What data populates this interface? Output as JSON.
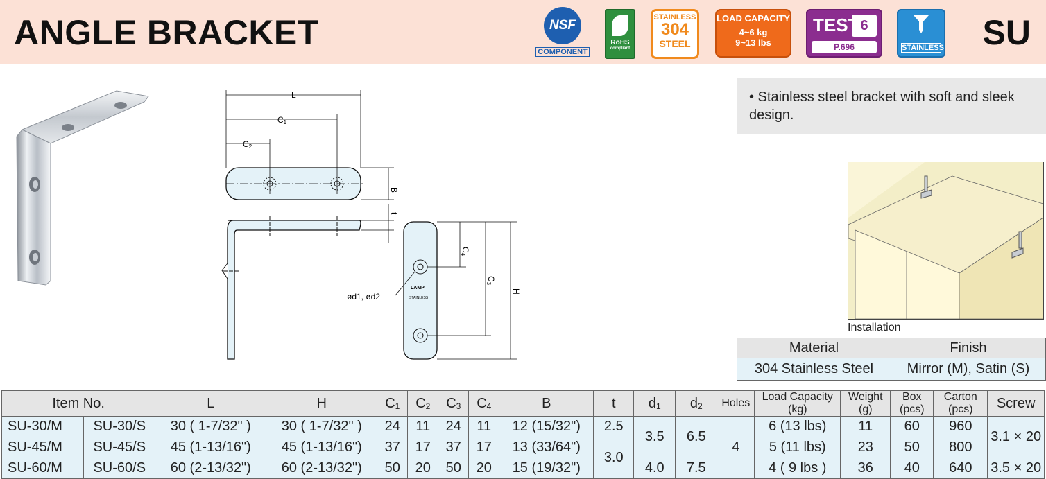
{
  "header": {
    "title": "ANGLE BRACKET",
    "series": "SU",
    "badges": {
      "nsf_logo": "NSF",
      "nsf_label": "COMPONENT",
      "rohs_label": "RoHS",
      "rohs_sub": "compliant",
      "steel_top": "STAINLESS",
      "steel_mid": "304",
      "steel_bot": "STEEL",
      "load_title": "LOAD CAPACITY",
      "load_kg": "4~6 kg",
      "load_lbs": "9~13 lbs",
      "test_label": "TEST",
      "test_num": "6",
      "test_page": "P.696",
      "stainless_label": "STAINLESS"
    }
  },
  "description": "• Stainless steel bracket with soft and sleek design.",
  "drawing_labels": {
    "L": "L",
    "C1": "C",
    "C1_sub": "1",
    "C2": "C",
    "C2_sub": "2",
    "B": "B",
    "t": "t",
    "C4": "C",
    "C4_sub": "4",
    "C3": "C",
    "C3_sub": "3",
    "H": "H",
    "holes": "ød1, ød2",
    "brand": "LAMP",
    "brand_sub": "STAINLESS"
  },
  "installation_label": "Installation",
  "material_table": {
    "headers": [
      "Material",
      "Finish"
    ],
    "row": [
      "304 Stainless Steel",
      "Mirror (M), Satin (S)"
    ]
  },
  "spec_table": {
    "headers": {
      "item_no": "Item No.",
      "L": "L",
      "H": "H",
      "C1": "C",
      "C2": "C",
      "C3": "C",
      "C4": "C",
      "B": "B",
      "t": "t",
      "d1": "d",
      "d2": "d",
      "holes": "Holes",
      "load": "Load Capacity (kg)",
      "weight": "Weight (g)",
      "box": "Box (pcs)",
      "carton": "Carton (pcs)",
      "screw": "Screw"
    },
    "rows": [
      {
        "item_m": "SU-30/M",
        "item_s": "SU-30/S",
        "L": "30 ( 1-7/32\" )",
        "H": "30 ( 1-7/32\" )",
        "C1": "24",
        "C2": "11",
        "C3": "24",
        "C4": "11",
        "B": "12 (15/32\")",
        "t": "2.5",
        "load": "6 (13 lbs)",
        "weight": "11",
        "box": "60",
        "carton": "960"
      },
      {
        "item_m": "SU-45/M",
        "item_s": "SU-45/S",
        "L": "45 (1-13/16\")",
        "H": "45 (1-13/16\")",
        "C1": "37",
        "C2": "17",
        "C3": "37",
        "C4": "17",
        "B": "13 (33/64\")",
        "load": "5 (11 lbs)",
        "weight": "23",
        "box": "50",
        "carton": "800"
      },
      {
        "item_m": "SU-60/M",
        "item_s": "SU-60/S",
        "L": "60 (2-13/32\")",
        "H": "60 (2-13/32\")",
        "C1": "50",
        "C2": "20",
        "C3": "50",
        "C4": "20",
        "B": "15 (19/32\")",
        "load": "4 ( 9 lbs )",
        "weight": "36",
        "box": "40",
        "carton": "640"
      }
    ],
    "merged": {
      "t_45_60": "3.0",
      "d1_30_45": "3.5",
      "d2_30_45": "6.5",
      "d1_60": "4.0",
      "d2_60": "7.5",
      "holes": "4",
      "screw_30_45": "3.1 × 20",
      "screw_60": "3.5 × 20"
    }
  }
}
